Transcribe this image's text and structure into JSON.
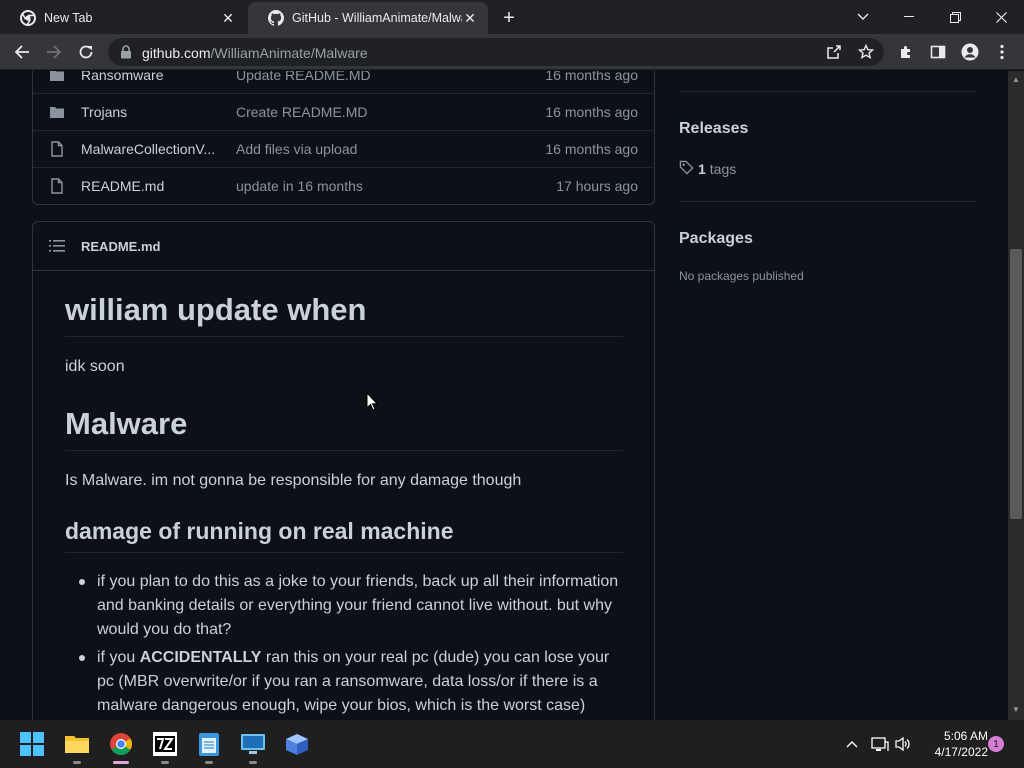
{
  "browser": {
    "tabs": [
      {
        "title": "New Tab"
      },
      {
        "title": "GitHub - WilliamAnimate/Malware"
      }
    ],
    "url_host": "github.com",
    "url_path": "/WilliamAnimate/Malware"
  },
  "files": [
    {
      "name": "Ransomware",
      "type": "folder",
      "message": "Update README.MD",
      "time": "16 months ago"
    },
    {
      "name": "Trojans",
      "type": "folder",
      "message": "Create README.MD",
      "time": "16 months ago"
    },
    {
      "name": "MalwareCollectionV...",
      "type": "file",
      "message": "Add files via upload",
      "time": "16 months ago"
    },
    {
      "name": "README.md",
      "type": "file",
      "message": "update in 16 months",
      "time": "17 hours ago"
    }
  ],
  "readme": {
    "title": "README.md",
    "h1_update": "william update when",
    "p_soon": "idk soon",
    "h1_malware": "Malware",
    "p_malware": "Is Malware. im not gonna be responsible for any damage though",
    "h2_damage": "damage of running on real machine",
    "bullets": [
      {
        "text": "if you plan to do this as a joke to your friends, back up all their information and banking details or everything your friend cannot live without. but why would you do that?"
      },
      {
        "pre": "if you ",
        "strong": "ACCIDENTALLY",
        "post": " ran this on your real pc (dude) you can lose your pc (MBR overwrite/or if you ran a ransomware, data loss/or if there is a malware dangerous enough, wipe your bios, which is the worst case)"
      }
    ]
  },
  "sidebar": {
    "releases_title": "Releases",
    "tags_count": "1",
    "tags_label": "tags",
    "packages_title": "Packages",
    "packages_empty": "No packages published"
  },
  "taskbar": {
    "time": "5:06 AM",
    "date": "4/17/2022",
    "notification_count": "1"
  }
}
